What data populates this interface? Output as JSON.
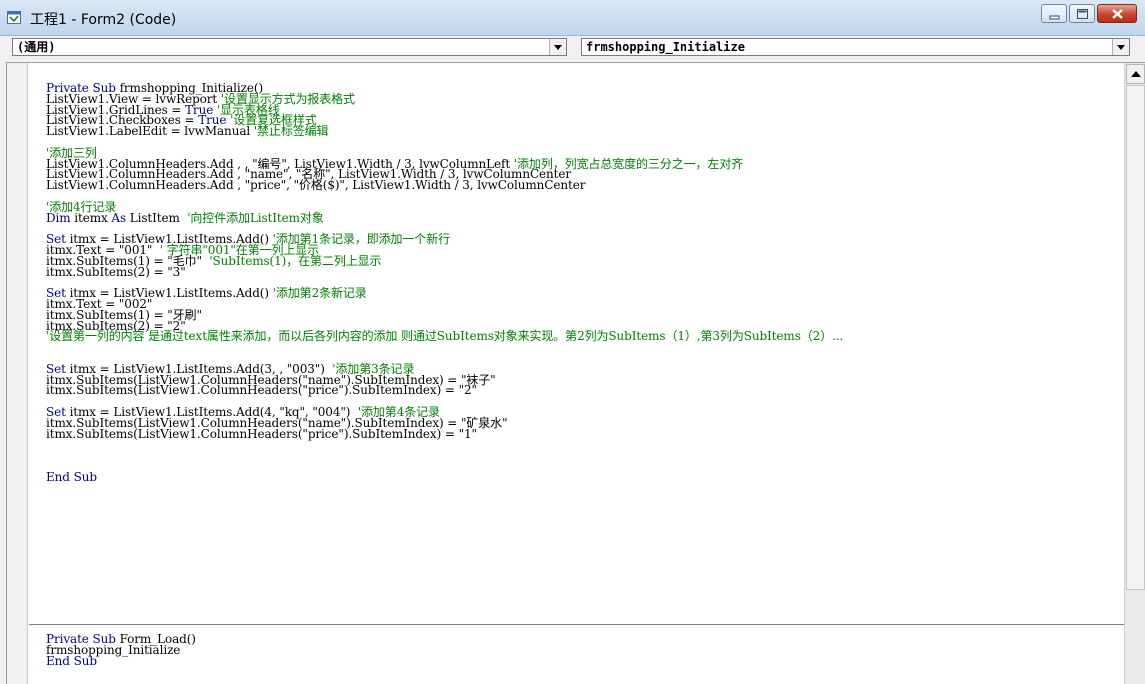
{
  "window": {
    "title": "工程1 - Form2 (Code)"
  },
  "combos": {
    "object": "(通用)",
    "procedure": "frmshopping_Initialize"
  },
  "code": {
    "proc1": [
      [
        [
          "kw",
          "Private Sub "
        ],
        [
          "t",
          "frmshopping_Initialize()"
        ]
      ],
      [
        [
          "t",
          "ListView1.View = lvwReport "
        ],
        [
          "cm",
          "'设置显示方式为报表格式"
        ]
      ],
      [
        [
          "t",
          "ListView1.GridLines = "
        ],
        [
          "kw",
          "True "
        ],
        [
          "cm",
          "'显示表格线"
        ]
      ],
      [
        [
          "t",
          "ListView1.Checkboxes = "
        ],
        [
          "kw",
          "True "
        ],
        [
          "cm",
          "'设置复选框样式"
        ]
      ],
      [
        [
          "t",
          "ListView1.LabelEdit = lvwManual "
        ],
        [
          "cm",
          "'禁止标签编辑"
        ]
      ],
      [],
      [
        [
          "cm",
          "'添加三列"
        ]
      ],
      [
        [
          "t",
          "ListView1.ColumnHeaders.Add , , \"编号\", ListView1.Width / 3, lvwColumnLeft "
        ],
        [
          "cm",
          "'添加列，列宽占总宽度的三分之一，左对齐"
        ]
      ],
      [
        [
          "t",
          "ListView1.ColumnHeaders.Add , \"name\", \"名称\", ListView1.Width / 3, lvwColumnCenter"
        ]
      ],
      [
        [
          "t",
          "ListView1.ColumnHeaders.Add , \"price\", \"价格($)\", ListView1.Width / 3, lvwColumnCenter"
        ]
      ],
      [],
      [
        [
          "cm",
          "'添加4行记录"
        ]
      ],
      [
        [
          "kw",
          "Dim "
        ],
        [
          "t",
          "itemx "
        ],
        [
          "kw",
          "As "
        ],
        [
          "t",
          "ListItem  "
        ],
        [
          "cm",
          "'向控件添加ListItem对象"
        ]
      ],
      [],
      [
        [
          "kw",
          "Set "
        ],
        [
          "t",
          "itmx = ListView1.ListItems.Add() "
        ],
        [
          "cm",
          "'添加第1条记录，即添加一个新行"
        ]
      ],
      [
        [
          "t",
          "itmx.Text = \"001\"  "
        ],
        [
          "cm",
          "' 字符串\"001\"在第一列上显示"
        ]
      ],
      [
        [
          "t",
          "itmx.SubItems(1) = \"毛巾\"  "
        ],
        [
          "cm",
          "'SubItems(1)，在第二列上显示"
        ]
      ],
      [
        [
          "t",
          "itmx.SubItems(2) = \"3\""
        ]
      ],
      [],
      [
        [
          "kw",
          "Set "
        ],
        [
          "t",
          "itmx = ListView1.ListItems.Add() "
        ],
        [
          "cm",
          "'添加第2条新记录"
        ]
      ],
      [
        [
          "t",
          "itmx.Text = \"002\""
        ]
      ],
      [
        [
          "t",
          "itmx.SubItems(1) = \"牙刷\""
        ]
      ],
      [
        [
          "t",
          "itmx.SubItems(2) = \"2\""
        ]
      ],
      [
        [
          "cm",
          "'设置第一列的内容 是通过text属性来添加，而以后各列内容的添加 则通过SubItems对象来实现。第2列为SubItems（1）,第3列为SubItems（2）..."
        ]
      ],
      [],
      [],
      [
        [
          "kw",
          "Set "
        ],
        [
          "t",
          "itmx = ListView1.ListItems.Add(3, , \"003\")  "
        ],
        [
          "cm",
          "'添加第3条记录"
        ]
      ],
      [
        [
          "t",
          "itmx.SubItems(ListView1.ColumnHeaders(\"name\").SubItemIndex) = \"袜子\""
        ]
      ],
      [
        [
          "t",
          "itmx.SubItems(ListView1.ColumnHeaders(\"price\").SubItemIndex) = \"2\""
        ]
      ],
      [],
      [
        [
          "kw",
          "Set "
        ],
        [
          "t",
          "itmx = ListView1.ListItems.Add(4, \"kq\", \"004\")  "
        ],
        [
          "cm",
          "'添加第4条记录"
        ]
      ],
      [
        [
          "t",
          "itmx.SubItems(ListView1.ColumnHeaders(\"name\").SubItemIndex) = \"矿泉水\""
        ]
      ],
      [
        [
          "t",
          "itmx.SubItems(ListView1.ColumnHeaders(\"price\").SubItemIndex) = \"1\""
        ]
      ],
      [],
      [],
      [],
      [
        [
          "kw",
          "End Sub"
        ]
      ]
    ],
    "proc2": [
      [
        [
          "kw",
          "Private Sub "
        ],
        [
          "t",
          "Form_Load()"
        ]
      ],
      [
        [
          "t",
          "frmshopping_Initialize"
        ]
      ],
      [
        [
          "kw",
          "End Sub"
        ]
      ]
    ]
  }
}
